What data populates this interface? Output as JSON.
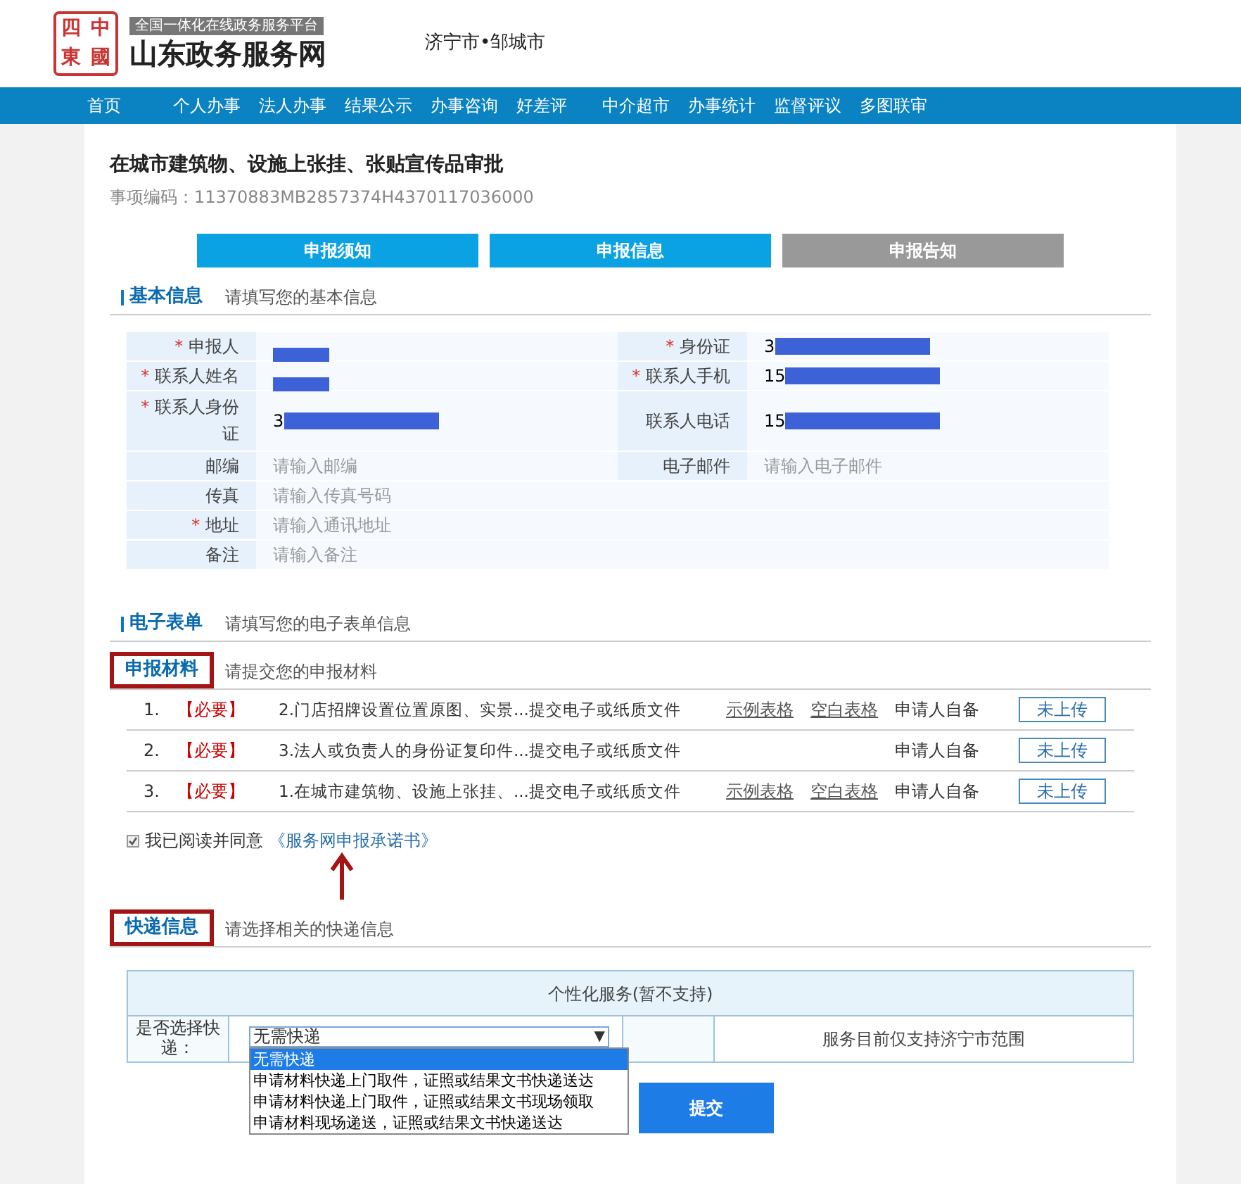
{
  "header": {
    "logo_chars": [
      "四",
      "中",
      "東",
      "國"
    ],
    "platform": "全国一体化在线政务服务平台",
    "site": "山东政务服务网",
    "region": "济宁市•邹城市"
  },
  "nav": [
    "首页",
    "个人办事",
    "法人办事",
    "结果公示",
    "办事咨询",
    "好差评",
    "中介超市",
    "办事统计",
    "监督评议",
    "多图联审"
  ],
  "title": "在城市建筑物、设施上张挂、张贴宣传品审批",
  "code": "事项编码：11370883MB2857374H4370117036000",
  "steps": [
    {
      "label": "申报须知",
      "active": true
    },
    {
      "label": "申报信息",
      "active": true
    },
    {
      "label": "申报告知",
      "active": false
    }
  ],
  "basic": {
    "title": "基本信息",
    "hint": "请填写您的基本信息",
    "rows": [
      [
        {
          "asterisk": "*",
          "label": "申报人",
          "redacted": true
        },
        {
          "asterisk": "*",
          "label": "身份证",
          "value": "3",
          "redacted": true
        }
      ],
      [
        {
          "asterisk": "*",
          "label": "联系人姓名",
          "redacted": true
        },
        {
          "asterisk": "*",
          "label": "联系人手机",
          "value": "15",
          "redacted": true
        }
      ],
      [
        {
          "asterisk": "*",
          "label": "联系人身份证",
          "value": "3",
          "redacted": true
        },
        {
          "label": "联系人电话",
          "value": "15",
          "redacted": true
        }
      ],
      [
        {
          "label": "邮编",
          "placeholder": "请输入邮编"
        },
        {
          "label": "电子邮件",
          "placeholder": "请输入电子邮件"
        }
      ],
      [
        {
          "label": "传真",
          "placeholder": "请输入传真号码"
        }
      ],
      [
        {
          "asterisk": "*",
          "label": "地址",
          "placeholder": "请输入通讯地址"
        }
      ],
      [
        {
          "label": "备注",
          "placeholder": "请输入备注"
        }
      ]
    ]
  },
  "eform": {
    "title": "电子表单",
    "hint": "请填写您的电子表单信息"
  },
  "materials": {
    "title": "申报材料",
    "hint": "请提交您的申报材料",
    "items": [
      {
        "num": "1.",
        "tag": "【必要】",
        "name": "2.门店招牌设置位置原图、实景...提交电子或纸质文件",
        "links": [
          "示例表格",
          "空白表格"
        ],
        "source": "申请人自备",
        "status": "未上传"
      },
      {
        "num": "2.",
        "tag": "【必要】",
        "name": "3.法人或负责人的身份证复印件...提交电子或纸质文件",
        "source": "申请人自备",
        "status": "未上传"
      },
      {
        "num": "3.",
        "tag": "【必要】",
        "name": "1.在城市建筑物、设施上张挂、...提交电子或纸质文件",
        "links": [
          "示例表格",
          "空白表格"
        ],
        "source": "申请人自备",
        "status": "未上传"
      }
    ],
    "agree": {
      "checked": true,
      "text": "我已阅读并同意",
      "link": "《服务网申报承诺书》"
    }
  },
  "express": {
    "title": "快递信息",
    "hint": "请选择相关的快递信息",
    "table_title": "个性化服务(暂不支持)",
    "question": "是否选择快递：",
    "select_value": "无需快递",
    "caret": "▼",
    "note": "服务目前仅支持济宁市范围",
    "options": [
      {
        "label": "无需快递",
        "selected": true
      },
      {
        "label": "申请材料快递上门取件，证照或结果文书快递送达",
        "selected": false
      },
      {
        "label": "申请材料快递上门取件，证照或结果文书现场领取",
        "selected": false
      },
      {
        "label": "申请材料现场递送，证照或结果文书快递送达",
        "selected": false
      }
    ]
  },
  "submit": "提交"
}
